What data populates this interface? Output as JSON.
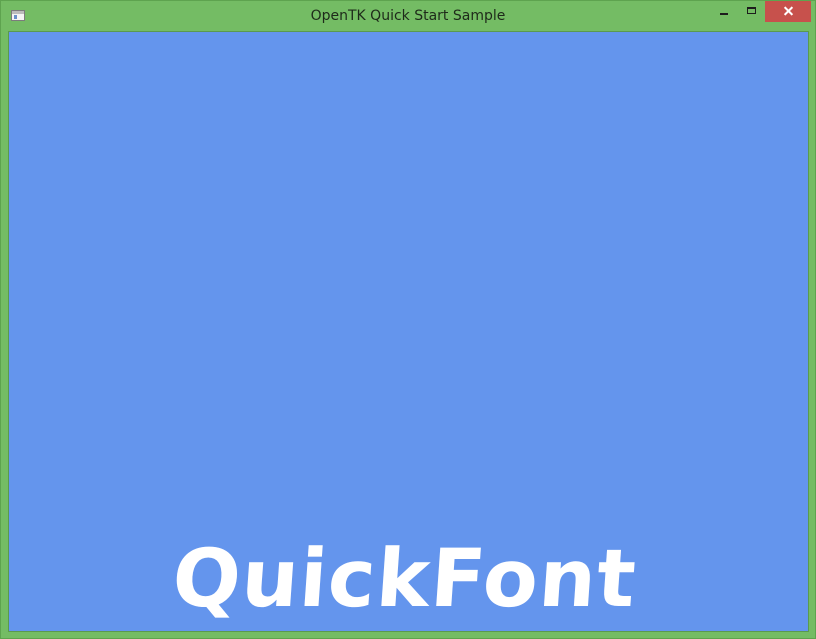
{
  "window": {
    "title": "OpenTK Quick Start Sample",
    "frame_color": "#74bc64",
    "close_color": "#c7514c"
  },
  "canvas": {
    "background_color": "#6495ed",
    "logo_text": "QuickFont"
  },
  "icons": {
    "app": "window-app-icon",
    "minimize": "minimize-icon",
    "maximize": "maximize-icon",
    "close": "close-icon"
  }
}
